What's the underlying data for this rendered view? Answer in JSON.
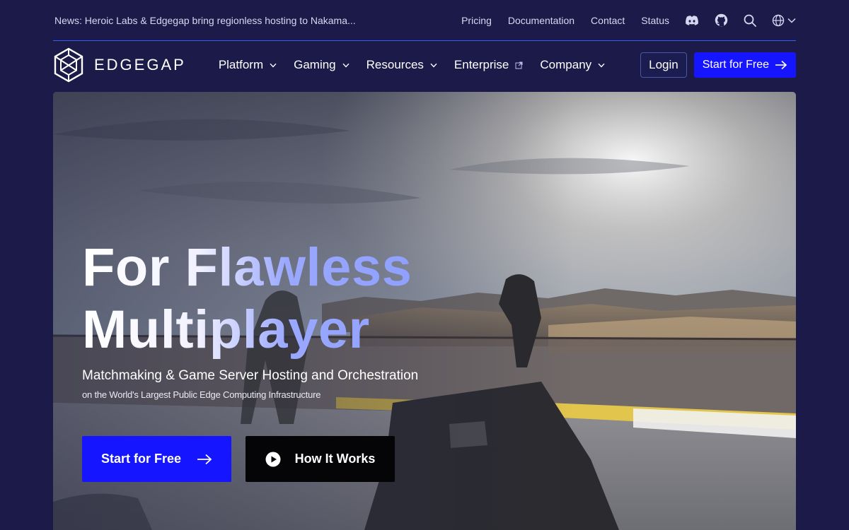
{
  "topbar": {
    "news": "News: Heroic Labs & Edgegap bring regionless hosting to Nakama...",
    "links": [
      "Pricing",
      "Documentation",
      "Contact",
      "Status"
    ],
    "icons": [
      "discord-icon",
      "github-icon",
      "search-icon",
      "globe-icon"
    ]
  },
  "brand": {
    "name": "EDGEGAP"
  },
  "nav": {
    "items": [
      "Platform",
      "Gaming",
      "Resources",
      "Enterprise",
      "Company"
    ],
    "login": "Login",
    "cta": "Start for Free"
  },
  "hero": {
    "headline_line1": "For Flawless",
    "headline_line2": "Multiplayer",
    "subtitle": "Matchmaking & Game Server Hosting and Orchestration",
    "subsubtitle": "on the World's Largest Public Edge Computing Infrastructure",
    "cta_primary": "Start for Free",
    "cta_secondary": "How It Works"
  },
  "colors": {
    "background": "#1b1a48",
    "accent": "#1515ff",
    "divider": "#3a5cff",
    "headline_gradient_end": "#8fa0ff"
  }
}
